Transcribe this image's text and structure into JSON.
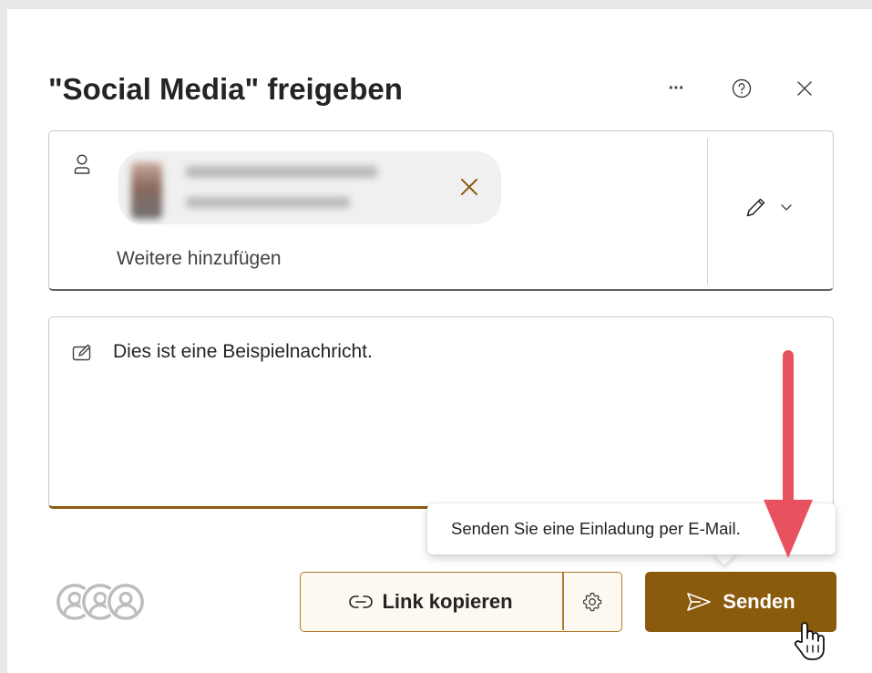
{
  "dialog": {
    "title": "\"Social Media\" freigeben",
    "more_label": "···",
    "help_icon": "help-circle-icon",
    "close_icon": "close-icon"
  },
  "recipients": {
    "person_icon": "person-icon",
    "chip_remove_icon": "close-icon",
    "add_more_placeholder": "Weitere hinzufügen",
    "permission_icon": "pencil-icon",
    "permission_chevron_icon": "chevron-down-icon"
  },
  "message": {
    "icon": "edit-note-icon",
    "text": "Dies ist eine Beispielnachricht."
  },
  "tooltip": {
    "text": "Senden Sie eine Einladung per E-Mail."
  },
  "actions": {
    "link_copy_label": "Link kopieren",
    "link_icon": "link-icon",
    "settings_icon": "gear-icon",
    "send_label": "Senden",
    "send_icon": "send-icon"
  },
  "colors": {
    "accent": "#8a5a0d",
    "accent_border": "#b07a2a",
    "annotation_arrow": "#e8515e"
  }
}
